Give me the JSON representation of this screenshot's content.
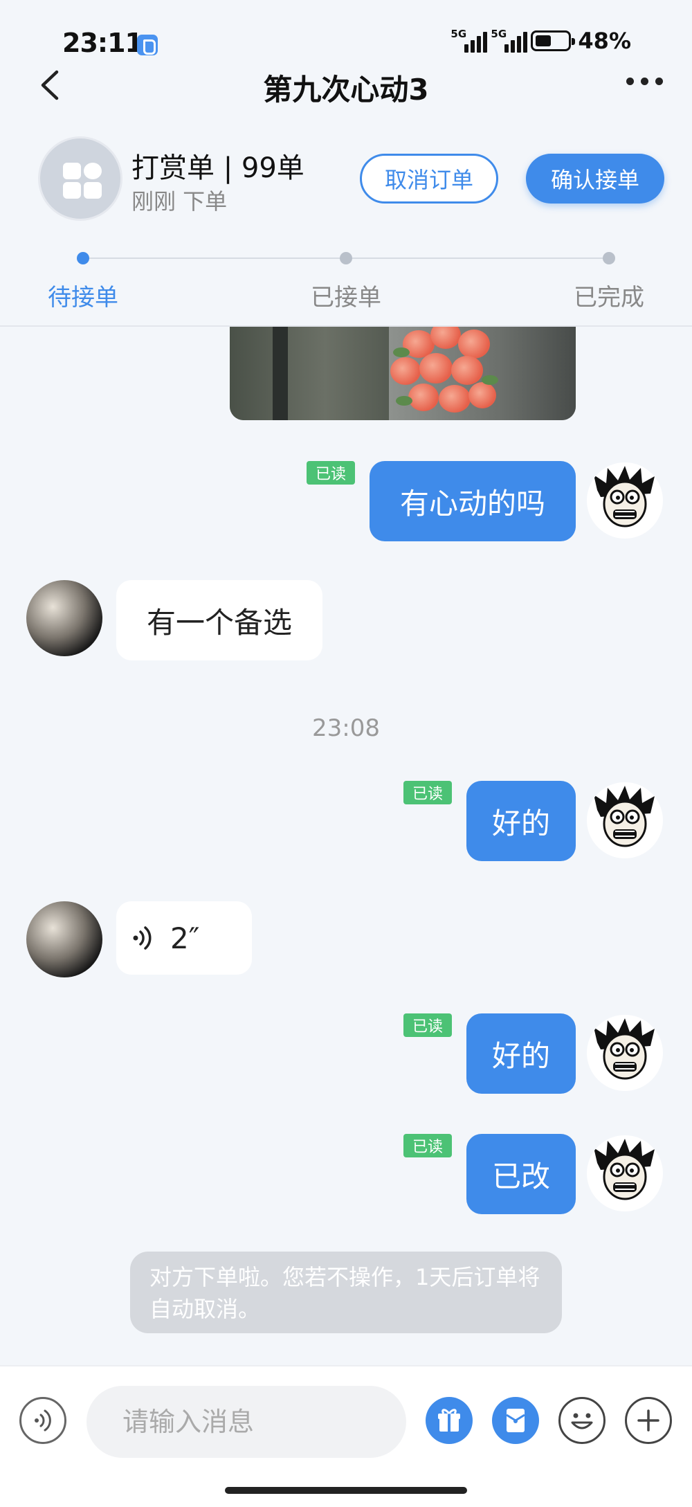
{
  "status_bar": {
    "time": "23:11",
    "network1": "5G",
    "network2": "5G",
    "battery": "48%"
  },
  "nav": {
    "title": "第九次心动3"
  },
  "order": {
    "title": "打赏单 | 99单",
    "subtitle": "刚刚 下单",
    "cancel_label": "取消订单",
    "confirm_label": "确认接单",
    "steps": [
      {
        "label": "待接单",
        "active": true
      },
      {
        "label": "已接单",
        "active": false
      },
      {
        "label": "已完成",
        "active": false
      }
    ]
  },
  "messages": [
    {
      "type": "image",
      "side": "out"
    },
    {
      "type": "text",
      "side": "out",
      "text": "有心动的吗",
      "read": "已读"
    },
    {
      "type": "text",
      "side": "in",
      "text": "有一个备选"
    },
    {
      "type": "time",
      "text": "23:08"
    },
    {
      "type": "text",
      "side": "out",
      "text": "好的",
      "read": "已读"
    },
    {
      "type": "voice",
      "side": "in",
      "text": "2″"
    },
    {
      "type": "text",
      "side": "out",
      "text": "好的",
      "read": "已读"
    },
    {
      "type": "text",
      "side": "out",
      "text": "已改",
      "read": "已读"
    }
  ],
  "system_message": "对方下单啦。您若不操作，1天后订单将自动取消。",
  "input": {
    "placeholder": "请输入消息"
  },
  "icons": {
    "voice": "voice-wave-icon",
    "gift": "gift-icon",
    "redpacket": "red-packet-icon",
    "emoji": "emoji-icon",
    "plus": "plus-icon"
  },
  "colors": {
    "accent": "#3f8bea",
    "read_badge": "#4cc275",
    "background": "#f3f6fa"
  }
}
